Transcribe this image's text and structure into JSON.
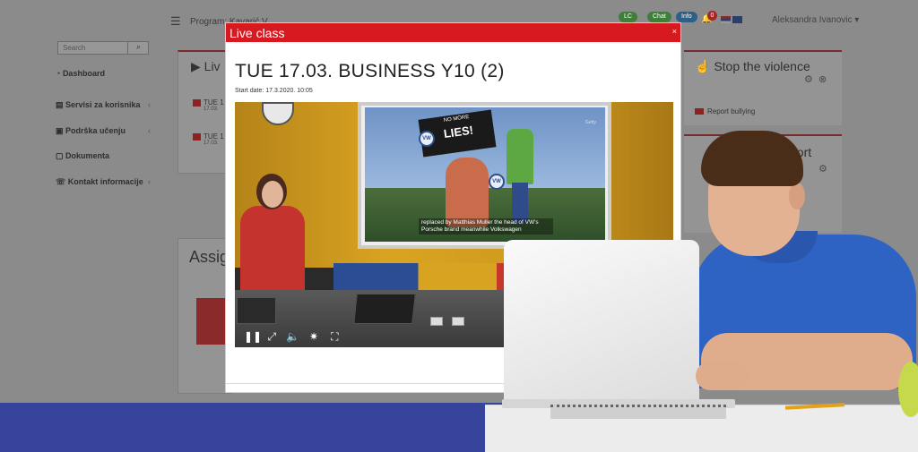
{
  "topbar": {
    "program_label": "Program: Kavarić V...",
    "pills": [
      "LC",
      "Chat",
      "Info"
    ],
    "notification_count": "0",
    "user_name": "Aleksandra Ivanovic"
  },
  "sidebar": {
    "search_placeholder": "Search",
    "items": [
      {
        "label": "Dashboard",
        "icon": "dashboard-icon",
        "has_submenu": false
      },
      {
        "label": "Servisi za korisnika",
        "icon": "services-icon",
        "has_submenu": true
      },
      {
        "label": "Podrška učenju",
        "icon": "learning-icon",
        "has_submenu": true
      },
      {
        "label": "Dokumenta",
        "icon": "documents-icon",
        "has_submenu": false
      },
      {
        "label": "Kontakt informacije",
        "icon": "contact-icon",
        "has_submenu": true
      }
    ]
  },
  "live_card": {
    "title": "Liv",
    "rows": [
      {
        "title": "TUE 1",
        "sub": "17.03."
      },
      {
        "title": "TUE 1",
        "sub": "17.03."
      }
    ]
  },
  "assign_card": {
    "title": "Assig"
  },
  "right_cards": {
    "stop_title": "Stop the violence",
    "report_link": "Report bullying",
    "second_title": "port"
  },
  "modal": {
    "title": "Live class",
    "close": "×",
    "class_title": "TUE 17.03. BUSINESS Y10 (2)",
    "start_date": "Start date: 17.3.2020. 10:05"
  },
  "video": {
    "sign_top": "NO MORE",
    "sign_main": "LIES!",
    "logo": "VW",
    "caption": "replaced by Matthias Muller the head of VW's Porsche brand meanwhile Volkswagen",
    "getty": "Getty",
    "controls": [
      "pause-icon",
      "resize-icon",
      "volume-icon",
      "settings-icon",
      "fullscreen-icon"
    ]
  },
  "colors": {
    "modal_header": "#d71920",
    "band_blue": "#36459b",
    "shirt_blue": "#2f63c3"
  }
}
